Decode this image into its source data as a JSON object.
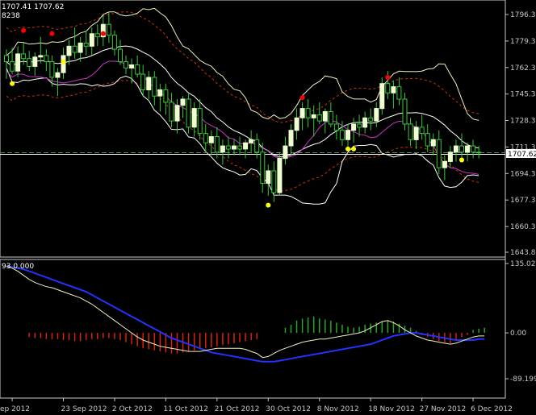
{
  "header": {
    "ohlc_text": "1707.41 1707.62",
    "volume_text": "8238",
    "indicator_text": "93 0.000"
  },
  "price_tag": "1707.62",
  "colors": {
    "background": "#000000",
    "grid": "#000000",
    "border": "#c8c8c8",
    "bull_candle": "#f0ffd0",
    "bear_candle": "#000000",
    "wick": "#33cc33",
    "bb_outer": "#ffffff",
    "bb_mid": "#ffffff",
    "ma_magenta": "#cc33cc",
    "envelope": "#cc3300",
    "fractal_up": "#ff0000",
    "fractal_down": "#ffff00",
    "hist_pos": "#22aa22",
    "hist_neg": "#dd2200",
    "signal_blue": "#2233ff",
    "line_white": "#ffffff"
  },
  "chart_data": [
    {
      "type": "candlestick",
      "y_ticks": [
        "1796.30",
        "1779.30",
        "1762.30",
        "1745.30",
        "1728.30",
        "1711.30",
        "1694.30",
        "1677.30",
        "1660.30",
        "1643.80"
      ],
      "y_tick_values": [
        1796.3,
        1779.3,
        1762.3,
        1745.3,
        1728.3,
        1711.3,
        1694.3,
        1677.3,
        1660.3,
        1643.8
      ],
      "ylim": [
        1643.8,
        1800.0
      ],
      "x_ticks": [
        "ep 2012",
        "23 Sep 2012",
        "2 Oct 2012",
        "11 Oct 2012",
        "21 Oct 2012",
        "30 Oct 2012",
        "8 Nov 2012",
        "18 Nov 2012",
        "27 Nov 2012",
        "6 Dec 2012"
      ],
      "x_tick_index": [
        1,
        10,
        19,
        28,
        37,
        46,
        55,
        64,
        73,
        82
      ],
      "current_price": 1707.62,
      "candles": [
        [
          1770,
          1774,
          1755,
          1766
        ],
        [
          1766,
          1775,
          1758,
          1760
        ],
        [
          1760,
          1776,
          1756,
          1771
        ],
        [
          1771,
          1778,
          1764,
          1768
        ],
        [
          1768,
          1773,
          1760,
          1763
        ],
        [
          1763,
          1772,
          1757,
          1769
        ],
        [
          1769,
          1782,
          1765,
          1770
        ],
        [
          1770,
          1774,
          1760,
          1766
        ],
        [
          1766,
          1770,
          1750,
          1756
        ],
        [
          1756,
          1762,
          1744,
          1759
        ],
        [
          1759,
          1775,
          1755,
          1770
        ],
        [
          1770,
          1780,
          1764,
          1776
        ],
        [
          1776,
          1788,
          1768,
          1772
        ],
        [
          1772,
          1782,
          1766,
          1778
        ],
        [
          1778,
          1786,
          1770,
          1776
        ],
        [
          1776,
          1788,
          1770,
          1784
        ],
        [
          1784,
          1790,
          1776,
          1782
        ],
        [
          1782,
          1796,
          1776,
          1790
        ],
        [
          1790,
          1798,
          1778,
          1783
        ],
        [
          1783,
          1786,
          1770,
          1774
        ],
        [
          1774,
          1780,
          1764,
          1766
        ],
        [
          1766,
          1770,
          1758,
          1762
        ],
        [
          1762,
          1768,
          1752,
          1764
        ],
        [
          1764,
          1770,
          1756,
          1758
        ],
        [
          1758,
          1764,
          1744,
          1748
        ],
        [
          1748,
          1760,
          1742,
          1756
        ],
        [
          1756,
          1760,
          1738,
          1744
        ],
        [
          1744,
          1752,
          1734,
          1748
        ],
        [
          1748,
          1752,
          1732,
          1740
        ],
        [
          1740,
          1746,
          1724,
          1728
        ],
        [
          1728,
          1742,
          1720,
          1738
        ],
        [
          1738,
          1744,
          1730,
          1742
        ],
        [
          1742,
          1746,
          1720,
          1724
        ],
        [
          1724,
          1740,
          1718,
          1736
        ],
        [
          1736,
          1742,
          1716,
          1720
        ],
        [
          1720,
          1726,
          1708,
          1714
        ],
        [
          1714,
          1722,
          1706,
          1718
        ],
        [
          1718,
          1724,
          1704,
          1708
        ],
        [
          1708,
          1716,
          1700,
          1712
        ],
        [
          1712,
          1718,
          1704,
          1710
        ],
        [
          1710,
          1716,
          1706,
          1712
        ],
        [
          1712,
          1718,
          1706,
          1710
        ],
        [
          1710,
          1716,
          1704,
          1714
        ],
        [
          1714,
          1722,
          1708,
          1716
        ],
        [
          1716,
          1720,
          1704,
          1708
        ],
        [
          1708,
          1714,
          1682,
          1688
        ],
        [
          1688,
          1700,
          1680,
          1696
        ],
        [
          1696,
          1702,
          1676,
          1682
        ],
        [
          1682,
          1708,
          1680,
          1704
        ],
        [
          1704,
          1718,
          1700,
          1712
        ],
        [
          1712,
          1726,
          1706,
          1722
        ],
        [
          1722,
          1736,
          1716,
          1730
        ],
        [
          1730,
          1740,
          1722,
          1736
        ],
        [
          1736,
          1742,
          1724,
          1730
        ],
        [
          1730,
          1738,
          1718,
          1732
        ],
        [
          1732,
          1740,
          1726,
          1728
        ],
        [
          1728,
          1736,
          1720,
          1734
        ],
        [
          1734,
          1740,
          1724,
          1726
        ],
        [
          1726,
          1732,
          1716,
          1722
        ],
        [
          1722,
          1728,
          1712,
          1716
        ],
        [
          1716,
          1726,
          1710,
          1722
        ],
        [
          1722,
          1730,
          1714,
          1726
        ],
        [
          1726,
          1732,
          1718,
          1724
        ],
        [
          1724,
          1734,
          1720,
          1730
        ],
        [
          1730,
          1736,
          1722,
          1728
        ],
        [
          1728,
          1740,
          1724,
          1736
        ],
        [
          1736,
          1756,
          1732,
          1752
        ],
        [
          1752,
          1760,
          1742,
          1746
        ],
        [
          1746,
          1754,
          1736,
          1750
        ],
        [
          1750,
          1756,
          1738,
          1742
        ],
        [
          1742,
          1746,
          1722,
          1726
        ],
        [
          1726,
          1730,
          1712,
          1716
        ],
        [
          1716,
          1728,
          1710,
          1724
        ],
        [
          1724,
          1732,
          1716,
          1720
        ],
        [
          1720,
          1726,
          1708,
          1712
        ],
        [
          1712,
          1720,
          1706,
          1716
        ],
        [
          1716,
          1722,
          1694,
          1698
        ],
        [
          1698,
          1706,
          1690,
          1702
        ],
        [
          1702,
          1712,
          1698,
          1708
        ],
        [
          1708,
          1716,
          1702,
          1712
        ],
        [
          1712,
          1720,
          1704,
          1708
        ],
        [
          1708,
          1714,
          1702,
          1712
        ],
        [
          1712,
          1716,
          1704,
          1708
        ],
        [
          1708,
          1712,
          1704,
          1707.62
        ]
      ],
      "fractals_up": [
        [
          3,
          1786
        ],
        [
          8,
          1784
        ],
        [
          17,
          1784
        ],
        [
          52,
          1743
        ],
        [
          67,
          1756
        ]
      ],
      "fractals_down": [
        [
          1,
          1752
        ],
        [
          10,
          1766
        ],
        [
          46,
          1674
        ],
        [
          60,
          1710
        ],
        [
          61,
          1710
        ],
        [
          80,
          1703
        ]
      ]
    },
    {
      "type": "oscillator",
      "y_ticks": [
        "135.021",
        "0.00",
        "-89.199"
      ],
      "y_tick_values": [
        135.021,
        0.0,
        -89.199
      ],
      "ylim": [
        -89.199,
        135.021
      ],
      "header_value": "0.000",
      "histogram": [
        0,
        0,
        0,
        0,
        -8,
        -10,
        -10,
        -12,
        -12,
        -12,
        -14,
        -14,
        -16,
        -16,
        -14,
        -12,
        -12,
        -10,
        -10,
        -12,
        -14,
        -18,
        -22,
        -26,
        -30,
        -32,
        -34,
        -36,
        -38,
        -40,
        -40,
        -38,
        -36,
        -34,
        -32,
        -30,
        -28,
        -26,
        -24,
        -22,
        -20,
        -18,
        -16,
        -14,
        -12,
        0,
        0,
        0,
        0,
        10,
        16,
        24,
        28,
        30,
        32,
        28,
        26,
        24,
        20,
        16,
        12,
        10,
        12,
        16,
        18,
        20,
        22,
        24,
        22,
        18,
        14,
        10,
        4,
        -4,
        -8,
        -12,
        -16,
        -18,
        -20,
        -14,
        -8,
        -4,
        6,
        8,
        10
      ],
      "line_white": [
        130,
        126,
        120,
        112,
        104,
        98,
        94,
        90,
        88,
        84,
        80,
        76,
        72,
        68,
        62,
        56,
        48,
        40,
        32,
        24,
        16,
        8,
        0,
        -8,
        -14,
        -18,
        -22,
        -26,
        -28,
        -30,
        -32,
        -34,
        -36,
        -36,
        -36,
        -34,
        -32,
        -30,
        -30,
        -30,
        -30,
        -30,
        -32,
        -36,
        -40,
        -48,
        -46,
        -40,
        -34,
        -30,
        -26,
        -22,
        -18,
        -16,
        -14,
        -12,
        -12,
        -10,
        -8,
        -6,
        -4,
        -2,
        0,
        4,
        10,
        16,
        22,
        24,
        20,
        14,
        6,
        0,
        -6,
        -10,
        -14,
        -16,
        -18,
        -20,
        -22,
        -20,
        -16,
        -12,
        -8,
        -6,
        -6
      ],
      "line_blue": [
        130,
        128,
        126,
        124,
        120,
        116,
        112,
        108,
        104,
        100,
        96,
        92,
        88,
        84,
        80,
        74,
        68,
        62,
        56,
        50,
        44,
        38,
        32,
        26,
        20,
        14,
        8,
        2,
        -4,
        -10,
        -14,
        -18,
        -22,
        -26,
        -30,
        -34,
        -38,
        -40,
        -42,
        -44,
        -46,
        -48,
        -50,
        -52,
        -54,
        -56,
        -56,
        -56,
        -54,
        -52,
        -50,
        -48,
        -46,
        -44,
        -42,
        -40,
        -38,
        -36,
        -34,
        -32,
        -30,
        -28,
        -26,
        -24,
        -22,
        -18,
        -14,
        -10,
        -6,
        -4,
        -2,
        0,
        0,
        -2,
        -4,
        -6,
        -8,
        -10,
        -12,
        -14,
        -14,
        -14,
        -14,
        -12,
        -12
      ]
    }
  ]
}
